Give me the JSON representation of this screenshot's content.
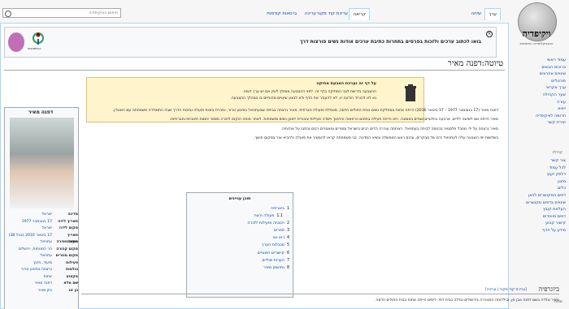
{
  "tabs": {
    "article": "ערך",
    "discussion": "שיחה",
    "read": "קריאה",
    "edit_source": "עריכת קוד מקור",
    "edit": "עריכה",
    "history": "גרסאות קודמות"
  },
  "search": {
    "placeholder": "חיפוש בוויקיפדיה"
  },
  "sidebar": {
    "logo_title": "ויקיפדיה",
    "logo_sub": "האנציקלופדיה החופשית",
    "nav": [
      "עמוד ראשי",
      "ברוכים הבאים",
      "שינויים אחרונים",
      "פורטלים",
      "ערך אקראי",
      "שער הקהילה",
      "עזרה",
      "ייצוא",
      "תרומה לוויקיפדיה",
      "יצירת קשר"
    ],
    "tools_head": "קהילה",
    "tools": [
      "צור קשר",
      "לכל עמוד",
      "דלפק ייעוץ",
      "מזנון",
      "כלים",
      "דפים המקושרים לכאן",
      "שינויים בדפים מקושרים",
      "העלאת קובץ",
      "דפים מיוחדים",
      "קישור קבוע",
      "מידע על הדף"
    ],
    "lang_head": "שפות"
  },
  "banner": {
    "text": "בואו לכתוב ערכים ולזכות בפרסים בתחרות כתיבת ערכים אודות נשים פורצות דרך",
    "logo_caption": "WIKIMEDIA"
  },
  "page_title": "טיוטה:דפנה מאיר",
  "notice": {
    "title": "על דף זה נערכת הצבעת מחיקה",
    "line1": "ההצבעה נדרשת לגבי המחיקה בדף זה. לפני ההצבעה מומלץ לעיין אם יש ערך דומה.",
    "line2": "נא לא להוריד הודעה זו, לא להעביר את הדף ולא לבצע שינויים מהותיים בו במהלך ההצבעה."
  },
  "infobox": {
    "title": "דפנה מאיר",
    "rows": [
      {
        "k": "מדינה",
        "v": "ישראל"
      },
      {
        "k": "תאריך לידה",
        "v": "17 בנובמבר 1977"
      },
      {
        "k": "מקום לידה",
        "v": "ישראל"
      },
      {
        "k": "תאריך פטירה",
        "v": "17 בינואר 2016 (בגיל 38)"
      },
      {
        "k": "מקום פטירה",
        "v": "עתניאל"
      },
      {
        "k": "מקום קבורה",
        "v": "הר המנוחות, ירושלים"
      },
      {
        "k": "מקום מגורים",
        "v": "עתניאל"
      },
      {
        "k": "פעילות",
        "v": "סיעוד, חינוך"
      },
      {
        "k": "בולטות",
        "v": "נרצחה בפיגוע טרור"
      },
      {
        "k": "מקצוע",
        "v": "אחות"
      },
      {
        "k": "שם מלא",
        "v": "דפנה מאיר"
      },
      {
        "k": "בן זוג",
        "v": "נתן מאיר"
      }
    ]
  },
  "body": {
    "p1": "דפנה מאיר (17 בנובמבר 1977 – 17 בינואר 2016) הייתה אחות במחלקת נשים בבית החולים הדסה, מטפלת ופעילה חברתית. מאיר נרצחה בביתה שבעתניאל בפיגוע טרור, ונזכרת בזכות פועלה ובזכות הדרך שבה התמודדה משפחתה עם האובדן.",
    "p2": "מאיר הייתה אם לשישה ילדים, ארבעה ביולוגיים ושניים באומנה. היא הייתה פעילה בתחום הרפואה והחינוך וייסדה פעילות ציבורית למען נשים ומשפחות. לאחר מותה הוקמו לזכרה מספר יוזמות חינוכיות וחברתיות.",
    "p3": "מאיר נרצחה על ידי מחבל פלסטיני בכניסה לביתה בעתניאל. רציחתה עוררה הדים רבים בישראל וספרים ומאמרים רבים נכתבו על אודותיה.",
    "p4": "בשלושת ימי השבעה עלה לעתניאל זרם של מבקרים, ובהם ראש הממשלה ונשיא המדינה. בני משפחתה קראו להמשיך את פועלה ולהביא אור במקום חושך."
  },
  "toc": {
    "title": "תוכן עניינים",
    "items": [
      {
        "n": "1",
        "t": "ביוגרפיה"
      },
      {
        "n": "1.1",
        "t": "פעולה ורצח"
      },
      {
        "n": "2",
        "t": "הנצחה ופעילות לזכרה"
      },
      {
        "n": "3",
        "t": "ספרים"
      },
      {
        "n": "4",
        "t": "ראו גם"
      },
      {
        "n": "5",
        "t": "מגבלות הערך"
      },
      {
        "n": "6",
        "t": "קישורים חיצוניים"
      },
      {
        "n": "7",
        "t": "הערות שוליים"
      },
      {
        "n": "8",
        "t": "נחושתן מאיר"
      }
    ]
  },
  "section": {
    "heading": "ביוגרפיה",
    "edit": "[עריכת קוד מקור | עריכה]",
    "first_line": "מאיר נולדה בשם דפנה אבן חן, ובילדותה התגוררה בירושלים וגדלה בבית דתי. לימים הייתה אחות בבית החולים הדסה."
  }
}
